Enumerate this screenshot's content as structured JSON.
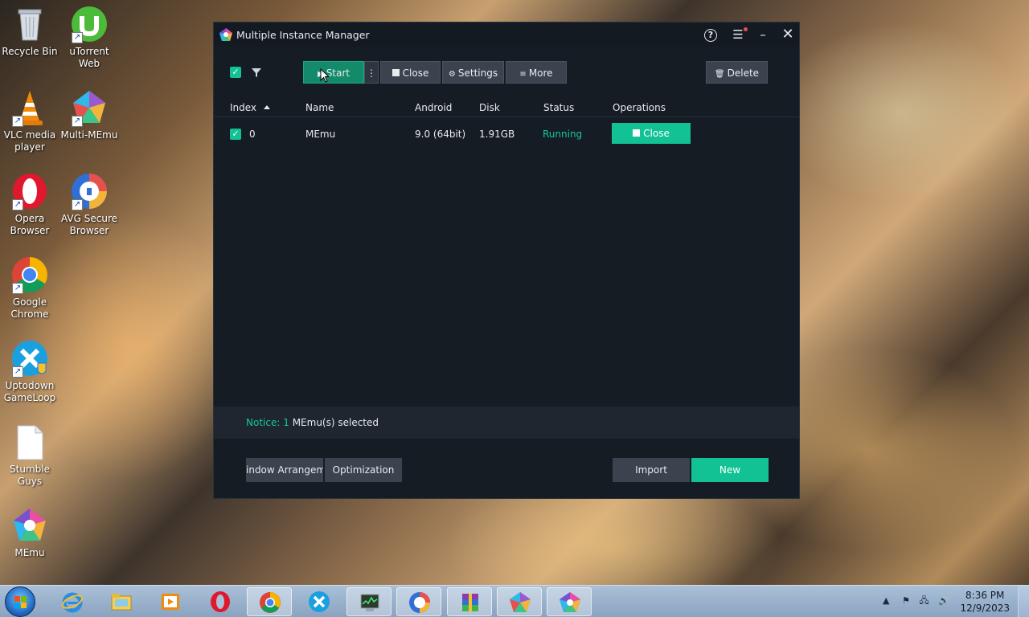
{
  "desktop": {
    "icons": [
      {
        "label": "Recycle Bin"
      },
      {
        "label": "uTorrent Web"
      },
      {
        "label": "VLC media player"
      },
      {
        "label": "Multi-MEmu"
      },
      {
        "label": "Opera Browser"
      },
      {
        "label": "AVG Secure Browser"
      },
      {
        "label": "Google Chrome"
      },
      {
        "label": "Uptodown GameLoop"
      },
      {
        "label": "Stumble Guys"
      },
      {
        "label": "MEmu"
      }
    ]
  },
  "window": {
    "title": "Multiple Instance Manager",
    "toolbar": {
      "start_label": "Start",
      "close_label": "Close",
      "settings_label": "Settings",
      "more_label": "More",
      "delete_label": "Delete"
    },
    "table": {
      "headers": [
        "Index",
        "Name",
        "Android",
        "Disk",
        "Status",
        "Operations"
      ],
      "rows": [
        {
          "index": "0",
          "name": "MEmu",
          "android": "9.0 (64bit)",
          "disk": "1.91GB",
          "status": "Running",
          "operation": "Close"
        }
      ]
    },
    "notice": {
      "prefix": "Notice:",
      "count": "1",
      "suffix": "MEmu(s) selected"
    },
    "bottom": {
      "window_arrangement_label": "indow Arrangeme",
      "optimization_label": "Optimization",
      "import_label": "Import",
      "new_label": "New"
    }
  },
  "taskbar": {
    "time": "8:36 PM",
    "date": "12/9/2023"
  },
  "colors": {
    "accent": "#12c294",
    "window_bg": "#161c24",
    "button_bg": "#3a434e"
  }
}
